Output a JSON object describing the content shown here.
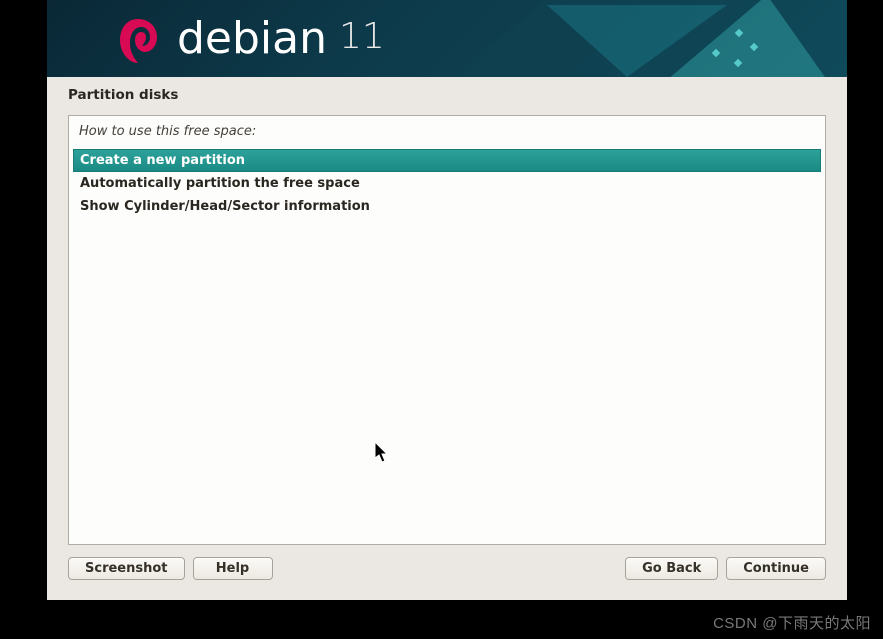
{
  "header": {
    "brand": "debian",
    "version": "11"
  },
  "section_title": "Partition disks",
  "prompt": "How to use this free space:",
  "options": [
    {
      "label": "Create a new partition",
      "selected": true
    },
    {
      "label": "Automatically partition the free space",
      "selected": false
    },
    {
      "label": "Show Cylinder/Head/Sector information",
      "selected": false
    }
  ],
  "buttons": {
    "screenshot": "Screenshot",
    "help": "Help",
    "go_back": "Go Back",
    "continue": "Continue"
  },
  "watermark": "CSDN @下雨天的太阳",
  "colors": {
    "accent": "#2e9c95",
    "panel_bg": "#ebe8e3",
    "banner_bg": "#0d3a4a"
  }
}
